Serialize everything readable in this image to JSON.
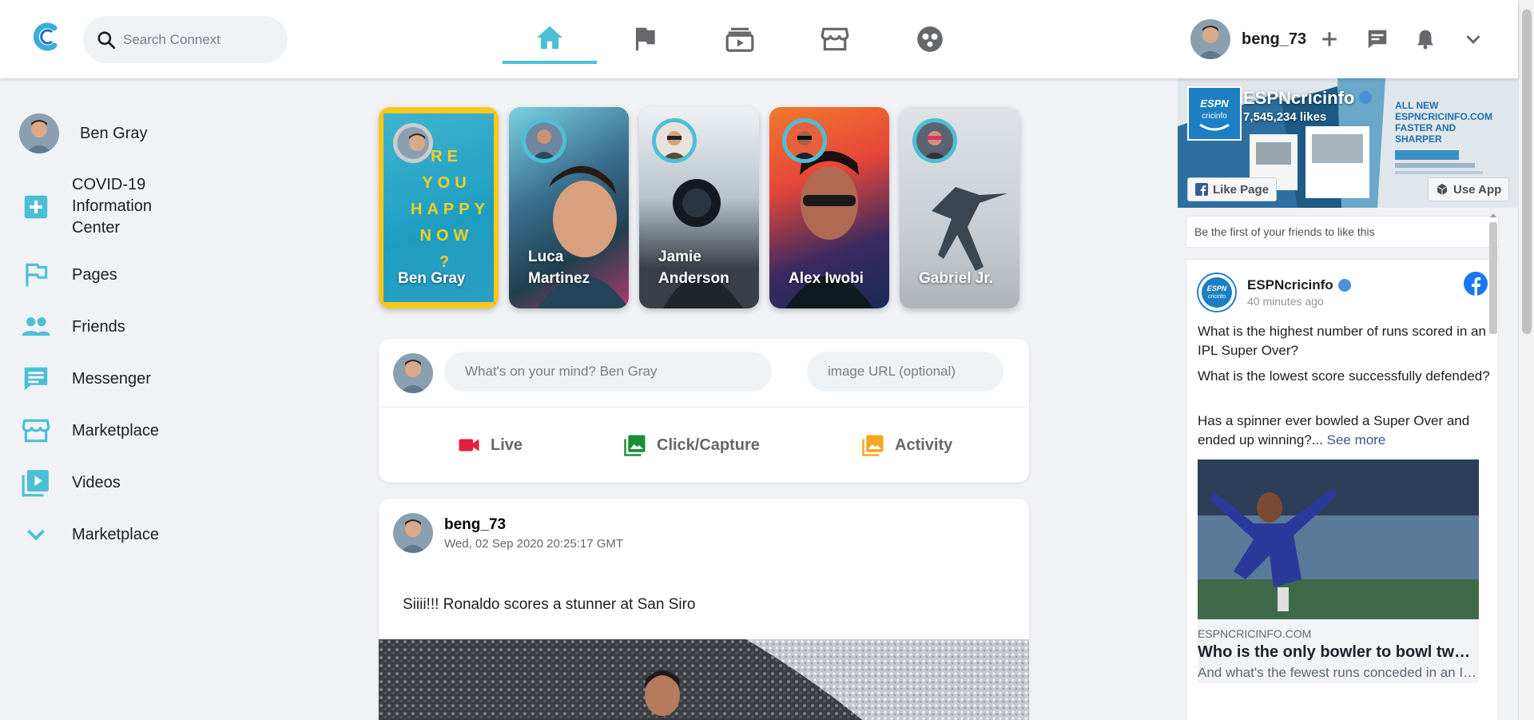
{
  "header": {
    "search_placeholder": "Search Connext",
    "username": "beng_73",
    "nav_tabs": [
      {
        "name": "home",
        "active": true
      },
      {
        "name": "pages",
        "active": false
      },
      {
        "name": "videos",
        "active": false
      },
      {
        "name": "marketplace",
        "active": false
      },
      {
        "name": "groups",
        "active": false
      }
    ],
    "accent_color": "#4bbfd6"
  },
  "sidebar": {
    "user_name": "Ben Gray",
    "items": [
      {
        "label": "COVID-19 Information Center",
        "icon": "plus-box-icon"
      },
      {
        "label": "Pages",
        "icon": "flag-icon"
      },
      {
        "label": "Friends",
        "icon": "people-icon"
      },
      {
        "label": "Messenger",
        "icon": "chat-icon"
      },
      {
        "label": "Marketplace",
        "icon": "store-icon"
      },
      {
        "label": "Videos",
        "icon": "video-library-icon"
      },
      {
        "label": "Marketplace",
        "icon": "chevron-down-icon"
      }
    ]
  },
  "stories": [
    {
      "name": "Ben Gray",
      "quote": "RE YOU HAPPY NOW ?"
    },
    {
      "name": "Luca Martinez"
    },
    {
      "name": "Jamie Anderson"
    },
    {
      "name": "Alex Iwobi"
    },
    {
      "name": "Gabriel Jr."
    }
  ],
  "composer": {
    "status_placeholder": "What's on your mind? Ben Gray",
    "image_placeholder": "image URL (optional)",
    "actions": {
      "live": "Live",
      "capture": "Click/Capture",
      "activity": "Activity"
    }
  },
  "post": {
    "username": "beng_73",
    "timestamp": "Wed, 02 Sep 2020 20:25:17 GMT",
    "text": "Siiii!!! Ronaldo scores a stunner at San Siro"
  },
  "page_plugin": {
    "cover_text": "ALL NEW ESPNCRICINFO.COM FASTER AND SHARPER",
    "page_name": "ESPNcricinfo",
    "likes": "7,545,234 likes",
    "like_button": "Like Page",
    "use_app_button": "Use App",
    "friends_text": "Be the first of your friends to like this",
    "post": {
      "author": "ESPNcricinfo",
      "time": "40 minutes ago",
      "paragraphs": [
        "What is the highest number of runs scored in an IPL Super Over?",
        "What is the lowest score successfully defended?",
        "Has a spinner ever bowled a Super Over and ended up winning?..."
      ],
      "see_more": "See more",
      "link_domain": "ESPNCRICINFO.COM",
      "link_title": "Who is the only bowler to bowl two Super Overs?",
      "link_desc": "And what's the fewest runs conceded in an IPL Super Over?"
    }
  }
}
